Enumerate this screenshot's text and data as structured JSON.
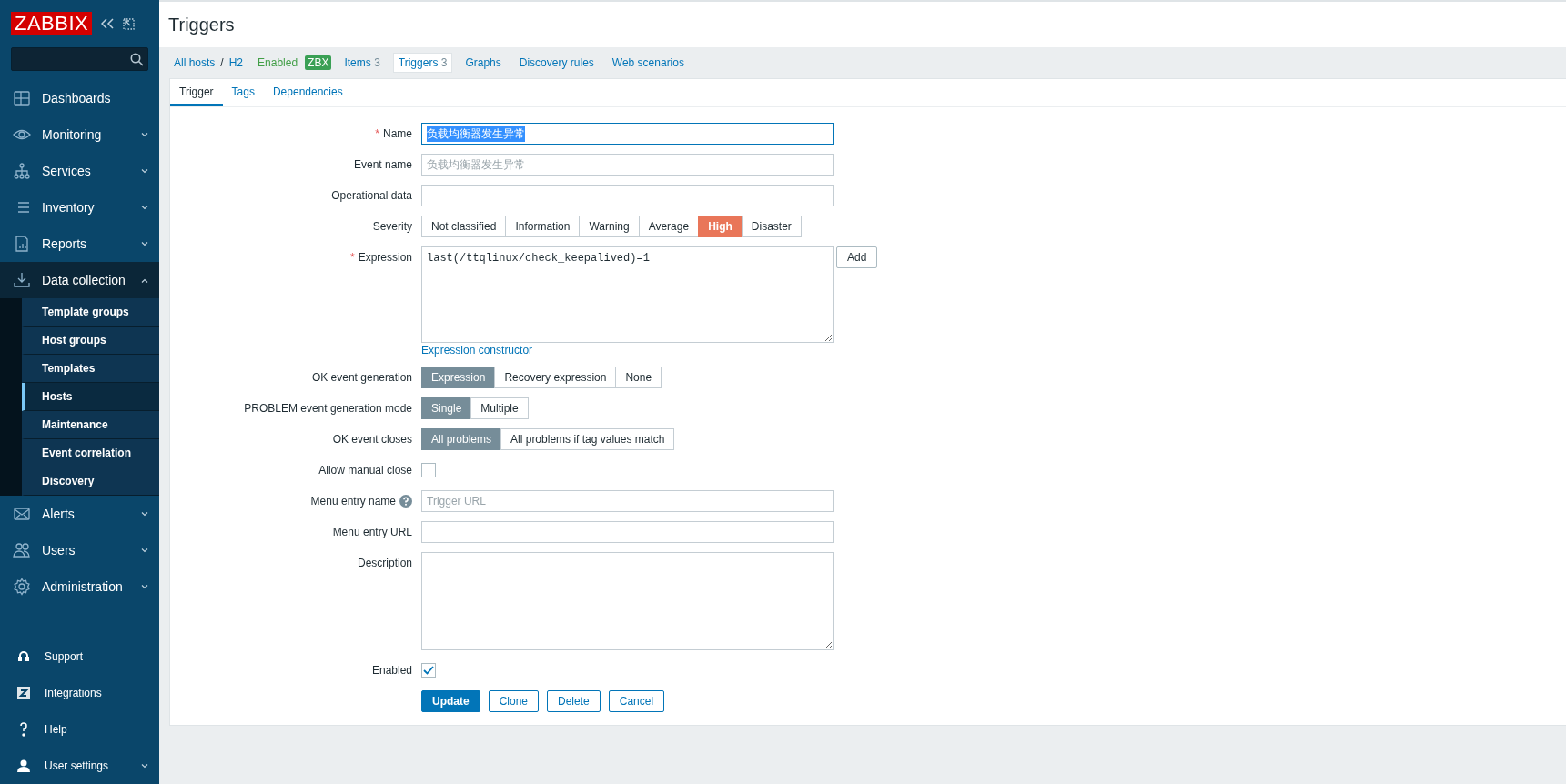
{
  "sidebar": {
    "logo": "ZABBIX",
    "menu": [
      {
        "label": "Dashboards"
      },
      {
        "label": "Monitoring",
        "expanded": false
      },
      {
        "label": "Services",
        "expanded": false
      },
      {
        "label": "Inventory",
        "expanded": false
      },
      {
        "label": "Reports",
        "expanded": false
      },
      {
        "label": "Data collection",
        "expanded": true,
        "children": [
          {
            "label": "Template groups",
            "selected": false
          },
          {
            "label": "Host groups",
            "selected": false
          },
          {
            "label": "Templates",
            "selected": false
          },
          {
            "label": "Hosts",
            "selected": true
          },
          {
            "label": "Maintenance",
            "selected": false
          },
          {
            "label": "Event correlation",
            "selected": false
          },
          {
            "label": "Discovery",
            "selected": false
          }
        ]
      },
      {
        "label": "Alerts",
        "expanded": false
      },
      {
        "label": "Users",
        "expanded": false
      },
      {
        "label": "Administration",
        "expanded": false
      }
    ],
    "bottom_menu": [
      {
        "label": "Support"
      },
      {
        "label": "Integrations"
      },
      {
        "label": "Help"
      },
      {
        "label": "User settings",
        "expanded": false
      }
    ]
  },
  "header": {
    "title": "Triggers"
  },
  "host_nav": {
    "breadcrumb": [
      "All hosts",
      "H2"
    ],
    "separator": "/",
    "status": "Enabled",
    "badge": "ZBX",
    "tabs": [
      {
        "label": "Items",
        "count": "3",
        "selected": false
      },
      {
        "label": "Triggers",
        "count": "3",
        "selected": true
      },
      {
        "label": "Graphs",
        "selected": false
      },
      {
        "label": "Discovery rules",
        "selected": false
      },
      {
        "label": "Web scenarios",
        "selected": false
      }
    ]
  },
  "form_tabs": [
    {
      "label": "Trigger",
      "selected": true
    },
    {
      "label": "Tags",
      "selected": false
    },
    {
      "label": "Dependencies",
      "selected": false
    }
  ],
  "form": [
    {
      "kind": "text",
      "label": "Name",
      "required_mark": "*",
      "value": "负载均衡器发生异常",
      "focused": true
    },
    {
      "kind": "text",
      "label": "Event name",
      "placeholder": "负载均衡器发生异常"
    },
    {
      "kind": "text",
      "label": "Operational data"
    },
    {
      "kind": "severity",
      "label": "Severity",
      "options": [
        {
          "label": "Not classified",
          "selected": false
        },
        {
          "label": "Information",
          "selected": false
        },
        {
          "label": "Warning",
          "selected": false
        },
        {
          "label": "Average",
          "selected": false
        },
        {
          "label": "High",
          "selected": true
        },
        {
          "label": "Disaster",
          "selected": false
        }
      ]
    },
    {
      "kind": "expression",
      "label": "Expression",
      "required_mark": "*",
      "value": "last(/ttqlinux/check_keepalived)=1",
      "button": "Add",
      "link": "Expression constructor"
    },
    {
      "kind": "segmented",
      "label": "OK event generation",
      "options": [
        {
          "label": "Expression",
          "selected": true
        },
        {
          "label": "Recovery expression",
          "selected": false
        },
        {
          "label": "None",
          "selected": false
        }
      ]
    },
    {
      "kind": "segmented",
      "label": "PROBLEM event generation mode",
      "options": [
        {
          "label": "Single",
          "selected": true
        },
        {
          "label": "Multiple",
          "selected": false
        }
      ]
    },
    {
      "kind": "segmented",
      "label": "OK event closes",
      "options": [
        {
          "label": "All problems",
          "selected": true
        },
        {
          "label": "All problems if tag values match",
          "selected": false
        }
      ]
    },
    {
      "kind": "checkbox",
      "label": "Allow manual close",
      "checked": false
    },
    {
      "kind": "text",
      "label": "Menu entry name",
      "help": true,
      "placeholder": "Trigger URL"
    },
    {
      "kind": "text",
      "label": "Menu entry URL"
    },
    {
      "kind": "textarea",
      "label": "Description"
    },
    {
      "kind": "checkbox",
      "label": "Enabled",
      "checked": true
    }
  ],
  "buttons": [
    {
      "label": "Update",
      "kind": "primary"
    },
    {
      "label": "Clone",
      "kind": "secondary"
    },
    {
      "label": "Delete",
      "kind": "secondary"
    },
    {
      "label": "Cancel",
      "kind": "secondary"
    }
  ]
}
